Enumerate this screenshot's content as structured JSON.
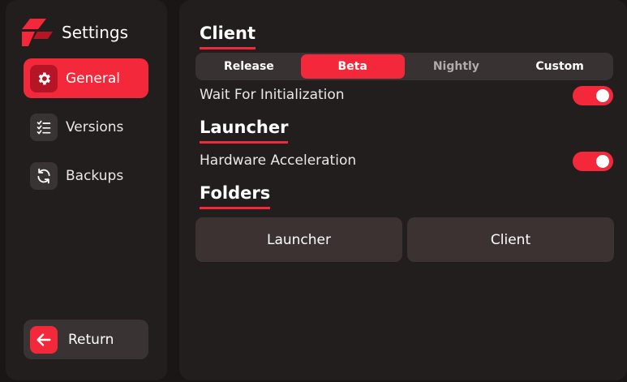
{
  "sidebar": {
    "title": "Settings",
    "items": [
      {
        "label": "General",
        "icon": "gear-icon",
        "active": true
      },
      {
        "label": "Versions",
        "icon": "checklist-icon",
        "active": false
      },
      {
        "label": "Backups",
        "icon": "refresh-icon",
        "active": false
      }
    ],
    "return_label": "Return"
  },
  "main": {
    "client": {
      "title": "Client",
      "channels": [
        "Release",
        "Beta",
        "Nightly",
        "Custom"
      ],
      "selected_channel": "Beta",
      "wait_for_init_label": "Wait For Initialization",
      "wait_for_init_on": true
    },
    "launcher": {
      "title": "Launcher",
      "hardware_accel_label": "Hardware Acceleration",
      "hardware_accel_on": true
    },
    "folders": {
      "title": "Folders",
      "buttons": [
        "Launcher",
        "Client"
      ]
    }
  },
  "colors": {
    "accent": "#f3283b",
    "background": "#1a1616",
    "panel": "#221e1e",
    "button": "#3a3333"
  }
}
